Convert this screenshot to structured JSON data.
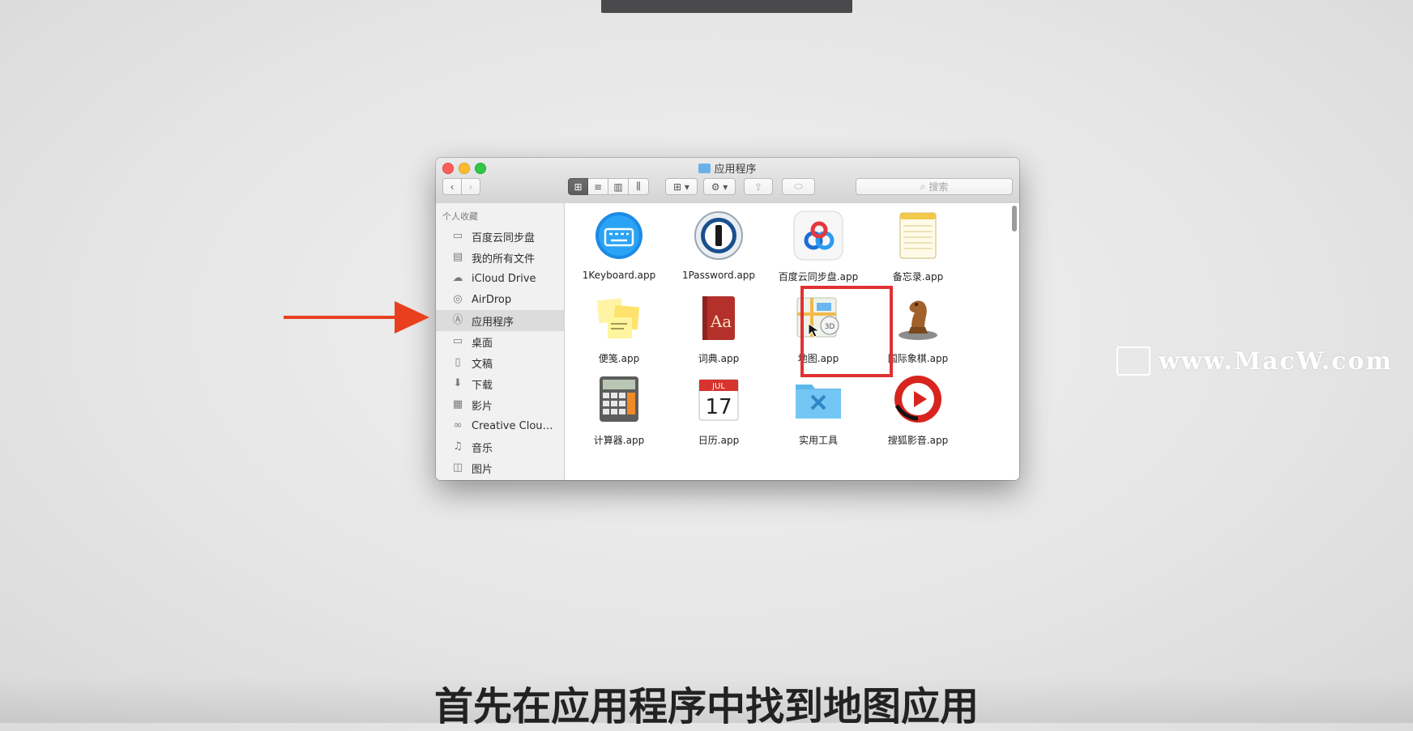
{
  "window": {
    "title": "应用程序",
    "search_placeholder": "搜索",
    "nav_back": "‹",
    "nav_forward": "›",
    "view_icon": "⊞",
    "view_list": "≡",
    "view_column": "▥",
    "view_coverflow": "⫼",
    "arrange_label": "⊞ ▾",
    "action_label": "⚙ ▾",
    "share_label": "⇪",
    "tag_label": "⬭"
  },
  "sidebar": {
    "header": "个人收藏",
    "items": [
      {
        "label": "百度云同步盘",
        "icon": "folder-icon",
        "glyph": "▭"
      },
      {
        "label": "我的所有文件",
        "icon": "all-files-icon",
        "glyph": "▤"
      },
      {
        "label": "iCloud Drive",
        "icon": "cloud-icon",
        "glyph": "☁"
      },
      {
        "label": "AirDrop",
        "icon": "airdrop-icon",
        "glyph": "◎"
      },
      {
        "label": "应用程序",
        "icon": "applications-icon",
        "glyph": "Ⓐ",
        "selected": true
      },
      {
        "label": "桌面",
        "icon": "desktop-icon",
        "glyph": "▭"
      },
      {
        "label": "文稿",
        "icon": "documents-icon",
        "glyph": "▯"
      },
      {
        "label": "下载",
        "icon": "downloads-icon",
        "glyph": "⬇"
      },
      {
        "label": "影片",
        "icon": "movies-icon",
        "glyph": "▦"
      },
      {
        "label": "Creative Clou…",
        "icon": "creative-cloud-icon",
        "glyph": "∞"
      },
      {
        "label": "音乐",
        "icon": "music-icon",
        "glyph": "♫"
      },
      {
        "label": "图片",
        "icon": "pictures-icon",
        "glyph": "◫"
      }
    ]
  },
  "apps": [
    {
      "name": "1Keyboard.app",
      "icon": "1keyboard-icon"
    },
    {
      "name": "1Password.app",
      "icon": "1password-icon"
    },
    {
      "name": "百度云同步盘.app",
      "icon": "baidu-cloud-icon"
    },
    {
      "name": "备忘录.app",
      "icon": "notes-icon"
    },
    {
      "name": "便笺.app",
      "icon": "stickies-icon"
    },
    {
      "name": "词典.app",
      "icon": "dictionary-icon"
    },
    {
      "name": "地图.app",
      "icon": "maps-icon"
    },
    {
      "name": "国际象棋.app",
      "icon": "chess-icon"
    },
    {
      "name": "计算器.app",
      "icon": "calculator-icon"
    },
    {
      "name": "日历.app",
      "icon": "calendar-icon"
    },
    {
      "name": "实用工具",
      "icon": "utilities-folder-icon"
    },
    {
      "name": "搜狐影音.app",
      "icon": "sohu-video-icon"
    }
  ],
  "calendar_icon": {
    "month": "JUL",
    "day": "17"
  },
  "dictionary_icon": {
    "text": "Aa"
  },
  "maps_icon": {
    "badge": "3D"
  },
  "watermark": "www.MacW.com",
  "caption": "首先在应用程序中找到地图应用",
  "colors": {
    "highlight": "#e03232",
    "arrow": "#e8401f",
    "selection": "#dcdcdc"
  }
}
